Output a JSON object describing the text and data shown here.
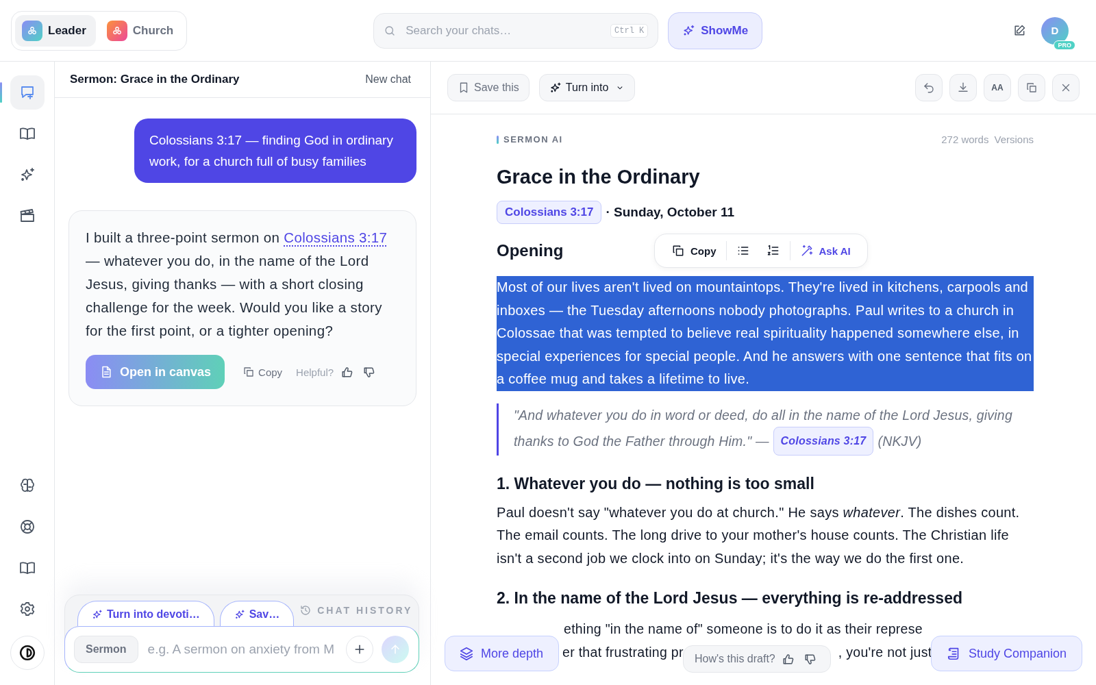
{
  "workspaces": [
    {
      "label": "Leader",
      "selected": true
    },
    {
      "label": "Church",
      "selected": false
    }
  ],
  "search": {
    "placeholder": "Search your chats…",
    "shortcut": "Ctrl K"
  },
  "showme": "ShowMe",
  "avatar": {
    "initial": "D",
    "badge": "PRO"
  },
  "rail": {
    "top": [
      {
        "kind": "new-chat",
        "selected": true
      },
      {
        "kind": "book",
        "selected": false
      },
      {
        "kind": "sparkle",
        "selected": false
      },
      {
        "kind": "clapper",
        "selected": false
      }
    ],
    "bottom": [
      {
        "kind": "brain"
      },
      {
        "kind": "lifebuoy"
      },
      {
        "kind": "book"
      },
      {
        "kind": "gear"
      },
      {
        "kind": "theme"
      }
    ]
  },
  "chat": {
    "title": "Sermon: Grace in the Ordinary",
    "new_chat": "New chat",
    "user_message": "Colossians 3:17 — finding God in ordinary work, for a church full of busy families",
    "reply_before": "I built a three-point sermon on ",
    "reply_link": "Colossians 3:17",
    "reply_after": " — whatever you do, in the name of the Lord Jesus, giving thanks — with a short closing challenge for the week. Would you like a story for the first point, or a tighter opening?",
    "open_canvas": "Open in canvas",
    "copy": "Copy",
    "helpful": "Helpful?"
  },
  "composer": {
    "suggestions": [
      "Turn into devoti…",
      "Sav…"
    ],
    "history": "CHAT HISTORY",
    "mode": "Sermon",
    "placeholder": "e.g. A sermon on anxiety from M"
  },
  "toolbar": {
    "save": "Save this",
    "turn_into": "Turn into",
    "tools": [
      {
        "kind": "undo"
      },
      {
        "kind": "download"
      },
      {
        "kind": "text-size",
        "label": "AA"
      },
      {
        "kind": "copy"
      },
      {
        "kind": "close"
      }
    ]
  },
  "doc": {
    "label": "SERMON AI",
    "word_count": "272 words",
    "versions": "Versions",
    "title": "Grace in the Ordinary",
    "ref": "Colossians 3:17",
    "date": "· Sunday, October 11",
    "opening": {
      "heading": "Opening",
      "selected": true,
      "text": "Most of our lives aren't lived on mountaintops. They're lived in kitchens, carpools and inboxes — the Tuesday afternoons nobody photographs. Paul writes to a church in Colossae that was tempted to believe real spirituality happened somewhere else, in special experiences for special people. And he answers with one sentence that fits on a coffee mug and takes a lifetime to live."
    },
    "popup": {
      "copy": "Copy",
      "ask": "Ask AI"
    },
    "quote": {
      "lines": [
        "\"And whatever you do in word or deed, do all in the name of the Lord Jesus, giving",
        "thanks to God the Father through Him.\" —"
      ],
      "ref": "Colossians 3:17",
      "version": "(NKJV)"
    },
    "point1": {
      "heading": "1. Whatever you do — nothing is too small",
      "text": "Paul doesn't say \"whatever you do at church.\" He says *whatever*. The dishes count. The email counts. The long drive to your mother's house counts. The Christian life isn't a second job we clock into on Sunday; it's the way we do the first one."
    },
    "point2": {
      "heading": "2. In the name of the Lord Jesus — everything is re-addressed",
      "line1": "ething \"in the name of\" someone is to do it as their represe",
      "line2": [
        "er that frustrating pr",
        ", you're not just"
      ]
    }
  },
  "floating": {
    "more_depth": "More depth",
    "draft": "How's this draft?",
    "study": "Study Companion"
  }
}
